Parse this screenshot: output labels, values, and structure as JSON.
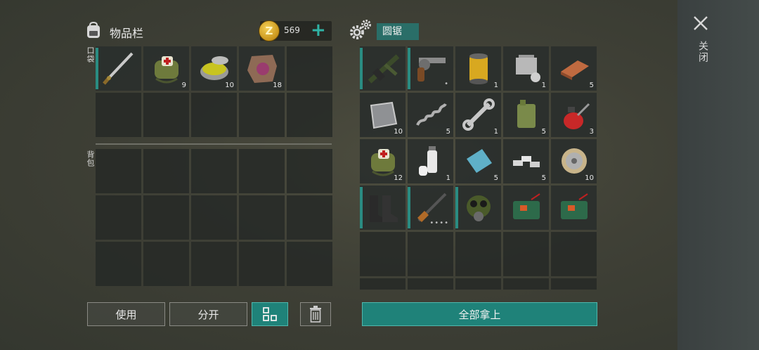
{
  "inventory": {
    "title": "物品栏",
    "coins": "569",
    "coin_symbol": "Z",
    "plus": "+",
    "pocket_label": "口袋",
    "backpack_label": "背包",
    "pocket_slots": [
      {
        "icon": "katana-icon",
        "qty": "",
        "durability": true
      },
      {
        "icon": "medkit-bag-icon",
        "qty": "9"
      },
      {
        "icon": "ointment-jar-icon",
        "qty": "10"
      },
      {
        "icon": "animal-hide-icon",
        "qty": "18"
      },
      {
        "icon": "",
        "qty": ""
      },
      {
        "icon": "",
        "qty": ""
      },
      {
        "icon": "",
        "qty": ""
      },
      {
        "icon": "",
        "qty": ""
      },
      {
        "icon": "",
        "qty": ""
      },
      {
        "icon": "",
        "qty": ""
      }
    ],
    "backpack_slot_count": 15
  },
  "station": {
    "name": "圆锯",
    "slots": [
      {
        "icon": "grenade-launcher-icon",
        "qty": "",
        "durability": true
      },
      {
        "icon": "revolver-icon",
        "qty": "",
        "durability": true,
        "dots": "•"
      },
      {
        "icon": "oil-filter-icon",
        "qty": "1"
      },
      {
        "icon": "engine-cylinder-icon",
        "qty": "1"
      },
      {
        "icon": "copper-ingot-icon",
        "qty": "5"
      },
      {
        "icon": "metal-plate-icon",
        "qty": "10"
      },
      {
        "icon": "spring-icon",
        "qty": "5"
      },
      {
        "icon": "wrench-icon",
        "qty": "1"
      },
      {
        "icon": "jerrycan-icon",
        "qty": "5"
      },
      {
        "icon": "oil-can-icon",
        "qty": "3"
      },
      {
        "icon": "medkit-bag-icon",
        "qty": "12"
      },
      {
        "icon": "spray-can-icon",
        "qty": "1"
      },
      {
        "icon": "glass-sheet-icon",
        "qty": "5"
      },
      {
        "icon": "aluminum-bars-icon",
        "qty": "5"
      },
      {
        "icon": "wire-spool-icon",
        "qty": "10"
      },
      {
        "icon": "boots-icon",
        "qty": "",
        "durability": true
      },
      {
        "icon": "rifle-icon",
        "qty": "",
        "durability": true,
        "dots": "••••"
      },
      {
        "icon": "gas-mask-icon",
        "qty": "",
        "durability": true
      },
      {
        "icon": "explosive-case-icon",
        "qty": ""
      },
      {
        "icon": "explosive-case-icon",
        "qty": ""
      },
      {
        "icon": "",
        "qty": ""
      },
      {
        "icon": "",
        "qty": ""
      },
      {
        "icon": "",
        "qty": ""
      },
      {
        "icon": "",
        "qty": ""
      },
      {
        "icon": "",
        "qty": ""
      },
      {
        "icon": "",
        "qty": ""
      },
      {
        "icon": "",
        "qty": ""
      },
      {
        "icon": "",
        "qty": ""
      },
      {
        "icon": "",
        "qty": ""
      },
      {
        "icon": "",
        "qty": ""
      }
    ]
  },
  "buttons": {
    "use": "使用",
    "split": "分开",
    "take_all": "全部拿上"
  },
  "close_label": "关闭",
  "colors": {
    "accent": "#1f8279",
    "coin": "#e0b13a"
  }
}
